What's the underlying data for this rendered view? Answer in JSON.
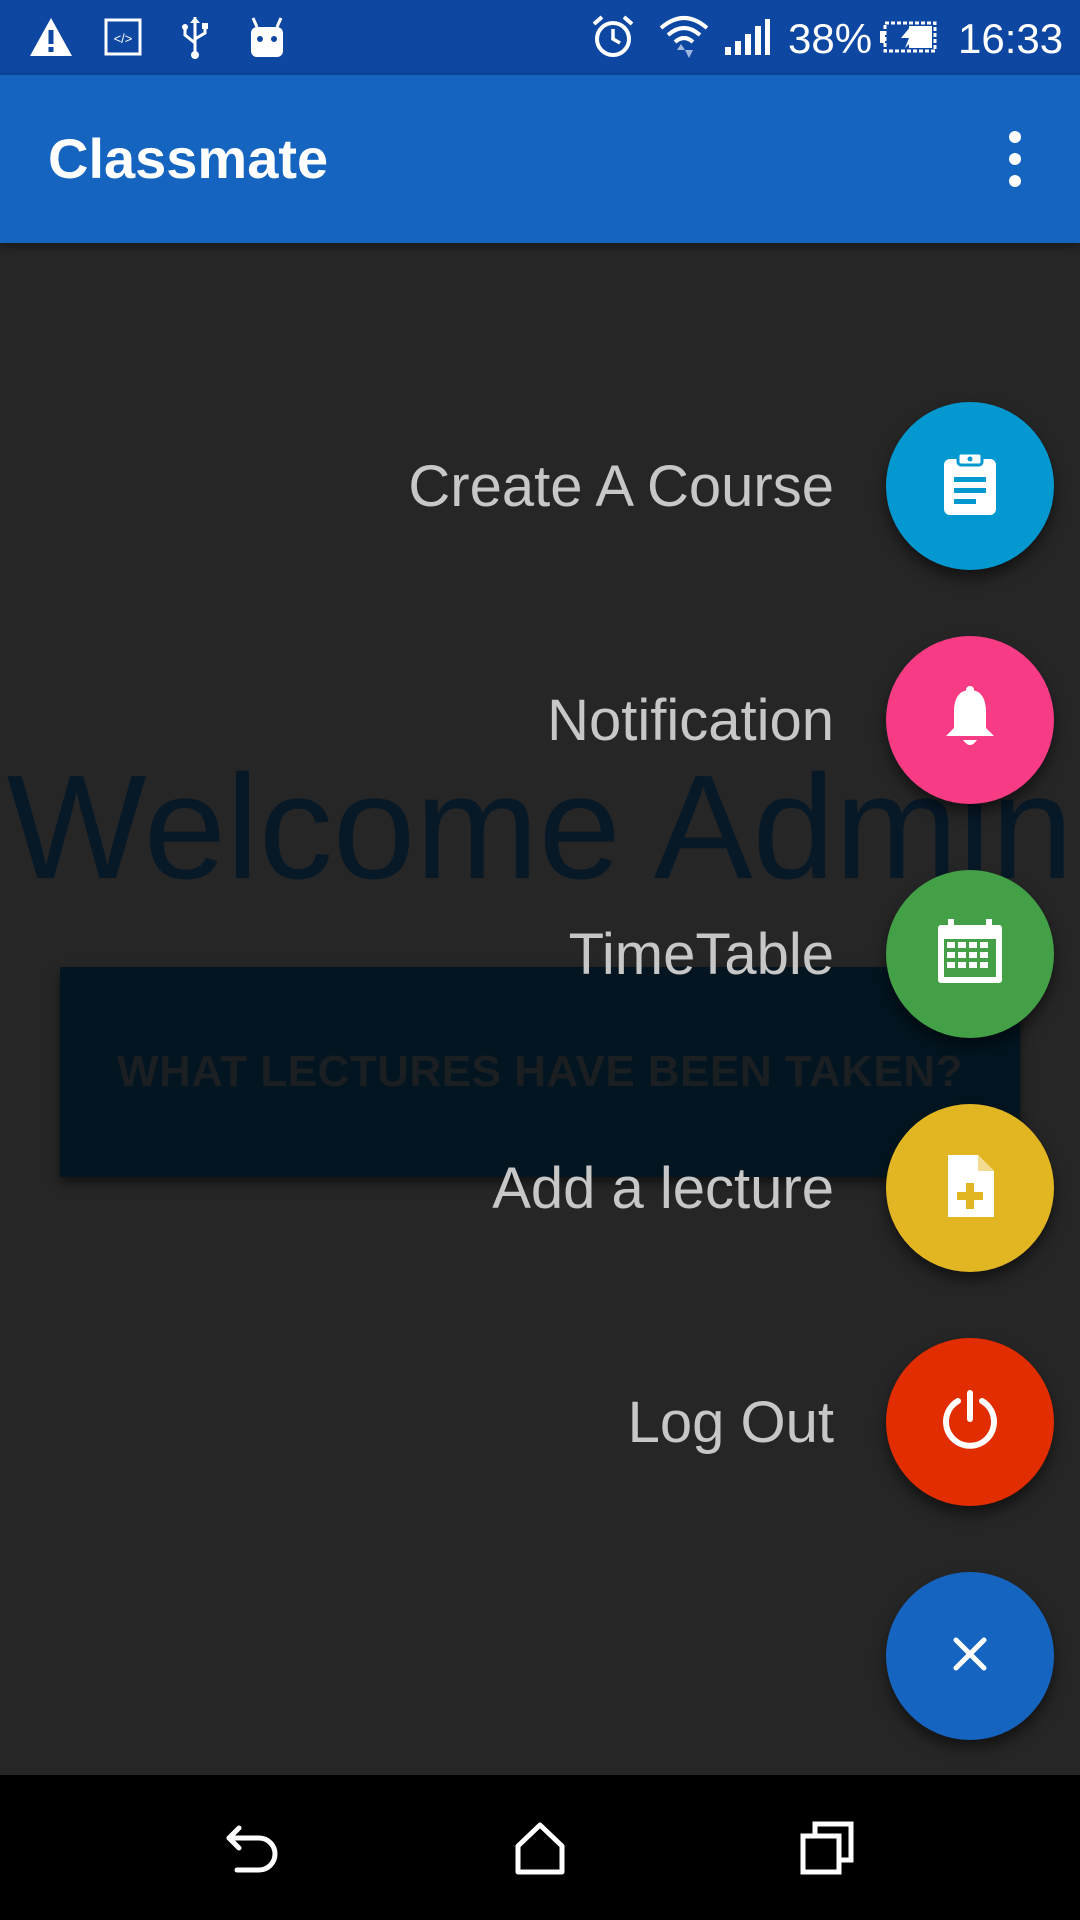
{
  "status_bar": {
    "battery_percent": "38%",
    "time": "16:33"
  },
  "app_bar": {
    "title": "Classmate"
  },
  "background": {
    "welcome_text": "Welcome Admin",
    "lectures_button": "WHAT LECTURES HAVE BEEN TAKEN?"
  },
  "fab_menu": {
    "items": [
      {
        "label": "Create A Course",
        "icon": "clipboard-icon",
        "color": "#0399d0"
      },
      {
        "label": "Notification",
        "icon": "bell-icon",
        "color": "#f73b84"
      },
      {
        "label": "TimeTable",
        "icon": "calendar-icon",
        "color": "#43a047"
      },
      {
        "label": "Add a lecture",
        "icon": "add-file-icon",
        "color": "#e2b623"
      },
      {
        "label": "Log Out",
        "icon": "power-icon",
        "color": "#e22d00"
      }
    ],
    "main_fab": {
      "icon": "close-icon",
      "color": "#1565c0"
    }
  },
  "colors": {
    "status_bar": "#0d47a1",
    "app_bar": "#1565c0",
    "background": "#262626"
  }
}
